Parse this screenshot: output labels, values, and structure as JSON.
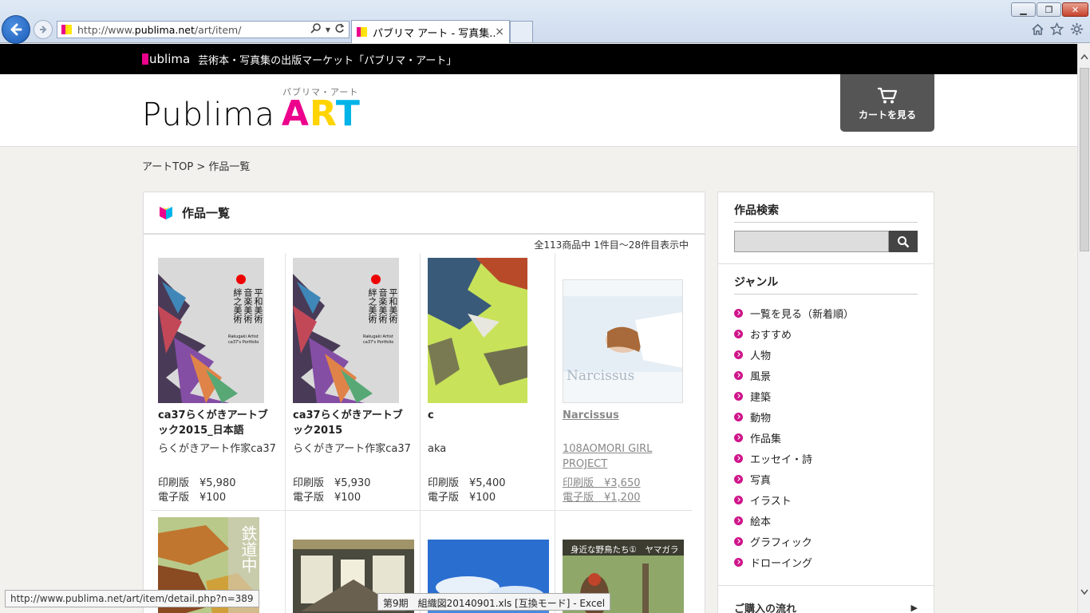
{
  "browser": {
    "url_prefix": "http://www.",
    "url_domain": "publima.net",
    "url_path": "/art/item/",
    "tab_title": "パブリマ アート - 写真集...",
    "tab_close": "×",
    "win_min": "▁",
    "win_max": "❐",
    "win_close": "✕",
    "icons": [
      "back-arrow-icon",
      "forward-arrow-icon",
      "search-icon",
      "refresh-icon",
      "home-icon",
      "star-icon",
      "gear-icon"
    ]
  },
  "topbar": {
    "brand": "ublima",
    "tagline": "芸術本・写真集の出版マーケット「パブリマ・アート」"
  },
  "header": {
    "logo_word": "Publima",
    "logo_art": [
      "A",
      "R",
      "T"
    ],
    "logo_kana": "パブリマ・アート",
    "cart_label": "カートを見る"
  },
  "breadcrumb": "アートTOP > 作品一覧",
  "main": {
    "heading": "作品一覧",
    "result_count": "全113商品中 1件目～28件目表示中",
    "items": [
      {
        "name": "ca37らくがきアートブック2015_日本語",
        "author": "らくがきアート作家ca37",
        "print_price": "印刷版　¥5,980",
        "ebook_price": "電子版　¥100"
      },
      {
        "name": "ca37らくがきアートブック2015",
        "author": "らくがきアート作家ca37",
        "print_price": "印刷版　¥5,930",
        "ebook_price": "電子版　¥100"
      },
      {
        "name": "c",
        "author": "aka",
        "print_price": "印刷版　¥5,400",
        "ebook_price": "電子版　¥100"
      },
      {
        "name": "Narcissus",
        "author": "108AOMORI GIRL PROJECT",
        "print_price": "印刷版　¥3,650",
        "ebook_price": "電子版　¥1,200"
      }
    ],
    "thumb_texts": {
      "book1_title": "平和美術 音楽美術 絆之美術",
      "book1_sub": "Rakugaki Artist ca37's Portfolio",
      "narcissus_title": "Narcissus",
      "book5_title": "鉄道中",
      "book8_title": "身近な野鳥たち①　ヤマガラ"
    }
  },
  "sidebar": {
    "search_heading": "作品検索",
    "genre_heading": "ジャンル",
    "genres": [
      "一覧を見る（新着順）",
      "おすすめ",
      "人物",
      "風景",
      "建築",
      "動物",
      "作品集",
      "エッセイ・詩",
      "写真",
      "イラスト",
      "絵本",
      "グラフィック",
      "ドローイング"
    ],
    "flow_label": "ご購入の流れ",
    "flow_arrow": "▶"
  },
  "status": {
    "link_url": "http://www.publima.net/art/item/detail.php?n=389",
    "taskbar_popup": "第9期　組織図20140901.xls  [互換モード] - Excel"
  },
  "colors": {
    "brand_magenta": "#ec008c",
    "brand_yellow": "#ffd400",
    "brand_cyan": "#00b4e8",
    "cart_bg": "#555555"
  }
}
